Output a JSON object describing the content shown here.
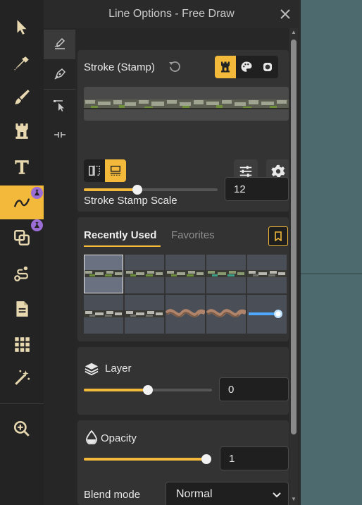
{
  "window": {
    "title": "Line Options - Free Draw"
  },
  "toolbar": {
    "tools": [
      "select",
      "eyedropper",
      "brush",
      "stamp",
      "text",
      "free-draw",
      "shapes",
      "path",
      "notes",
      "grid",
      "magic-wand",
      "zoom"
    ]
  },
  "stroke": {
    "title": "Stroke (Stamp)",
    "scale_label": "Stroke Stamp Scale",
    "scale_value": "12",
    "scale_fraction": 0.4
  },
  "library": {
    "tab_recent": "Recently Used",
    "tab_favorites": "Favorites"
  },
  "layer": {
    "label": "Layer",
    "value": "0",
    "fraction": 0.5
  },
  "opacity": {
    "label": "Opacity",
    "value": "1",
    "fraction": 1.0
  },
  "blend": {
    "label": "Blend mode",
    "value": "Normal"
  },
  "colors": {
    "accent": "#f2b93b",
    "panel": "#2a2a2a",
    "badge": "#9b6ed6"
  }
}
